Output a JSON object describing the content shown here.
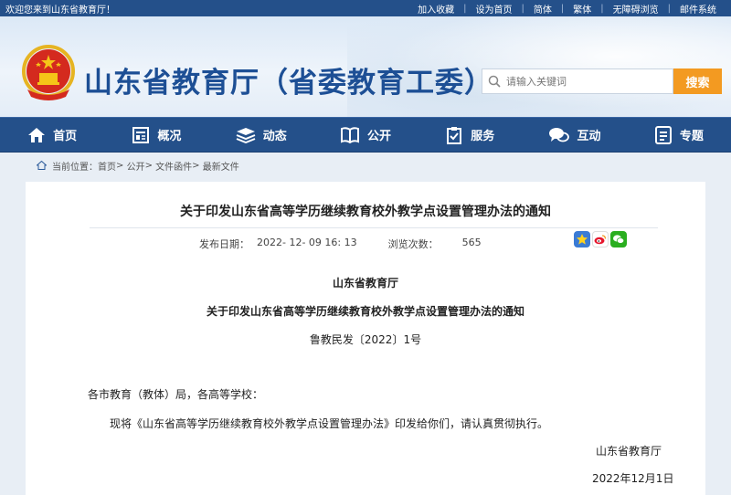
{
  "topbar": {
    "welcome": "欢迎您来到山东省教育厅！",
    "links": [
      "加入收藏",
      "设为首页",
      "简体",
      "繁体",
      "无障碍浏览",
      "邮件系统"
    ]
  },
  "header": {
    "site_title": "山东省教育厅（省委教育工委）",
    "search_placeholder": "请输入关键词",
    "search_button": "搜索"
  },
  "nav": {
    "items": [
      {
        "label": "首页",
        "icon": "home-icon"
      },
      {
        "label": "概况",
        "icon": "overview-icon"
      },
      {
        "label": "动态",
        "icon": "news-stack-icon"
      },
      {
        "label": "公开",
        "icon": "book-icon"
      },
      {
        "label": "服务",
        "icon": "clipboard-icon"
      },
      {
        "label": "互动",
        "icon": "chat-icon"
      },
      {
        "label": "专题",
        "icon": "topic-icon"
      }
    ]
  },
  "breadcrumb": {
    "prefix": "当前位置：",
    "items": [
      "首页",
      "公开",
      "文件函件",
      "最新文件"
    ],
    "separator": ">"
  },
  "article": {
    "title": "关于印发山东省高等学历继续教育校外教学点设置管理办法的通知",
    "publish_label": "发布日期：",
    "publish_date": "2022- 12- 09 16: 13",
    "views_label": "浏览次数：",
    "views": "565",
    "issuer": "山东省教育厅",
    "subtitle": "关于印发山东省高等学历继续教育校外教学点设置管理办法的通知",
    "doc_number": "鲁教民发〔2022〕1号",
    "salutation": "各市教育（教体）局，各高等学校：",
    "paragraph": "现将《山东省高等学历继续教育校外教学点设置管理办法》印发给你们，请认真贯彻执行。",
    "signature": "山东省教育厅",
    "sign_date": "2022年12月1日"
  },
  "share": {
    "icons": [
      "qzone-icon",
      "weibo-icon",
      "wechat-icon"
    ]
  },
  "colors": {
    "nav_bg": "#24508a",
    "title_blue": "#1d4f95",
    "search_orange": "#f39a21"
  }
}
